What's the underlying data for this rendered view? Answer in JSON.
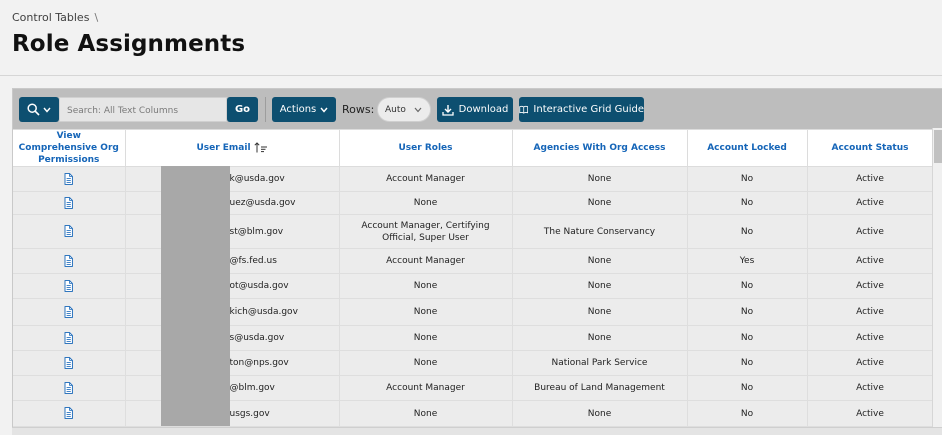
{
  "breadcrumb": {
    "parent": "Control Tables",
    "separator": "\\"
  },
  "page": {
    "title": "Role Assignments"
  },
  "toolbar": {
    "search_placeholder": "Search: All Text Columns",
    "go_label": "Go",
    "actions_label": "Actions",
    "rows_label": "Rows:",
    "rows_value": "Auto",
    "download_label": "Download",
    "guide_label": "Interactive Grid Guide"
  },
  "grid": {
    "columns": [
      "View Comprehensive Org Permissions",
      "User Email",
      "User Roles",
      "Agencies With Org Access",
      "Account Locked",
      "Account Status"
    ],
    "rows": [
      {
        "email": "k@usda.gov",
        "roles": "Account Manager",
        "agencies": "None",
        "locked": "No",
        "status": "Active"
      },
      {
        "email": "uez@usda.gov",
        "roles": "None",
        "agencies": "None",
        "locked": "No",
        "status": "Active"
      },
      {
        "email": "st@blm.gov",
        "roles": "Account Manager, Certifying Official, Super User",
        "agencies": "The Nature Conservancy",
        "locked": "No",
        "status": "Active"
      },
      {
        "email": "@fs.fed.us",
        "roles": "Account Manager",
        "agencies": "None",
        "locked": "Yes",
        "status": "Active"
      },
      {
        "email": "ot@usda.gov",
        "roles": "None",
        "agencies": "None",
        "locked": "No",
        "status": "Active"
      },
      {
        "email": "kich@usda.gov",
        "roles": "None",
        "agencies": "None",
        "locked": "No",
        "status": "Active"
      },
      {
        "email": "s@usda.gov",
        "roles": "None",
        "agencies": "None",
        "locked": "No",
        "status": "Active"
      },
      {
        "email": "ton@nps.gov",
        "roles": "None",
        "agencies": "National Park Service",
        "locked": "No",
        "status": "Active"
      },
      {
        "email": "@blm.gov",
        "roles": "Account Manager",
        "agencies": "Bureau of Land Management",
        "locked": "No",
        "status": "Active"
      },
      {
        "email": "usgs.gov",
        "roles": "None",
        "agencies": "None",
        "locked": "No",
        "status": "Active"
      }
    ]
  },
  "colors": {
    "accent": "#0d4f70",
    "link": "#1565b8",
    "toolbar": "#bdbdbd",
    "redaction": "#a8a8a8"
  },
  "icons": [
    "search-icon",
    "chevron-down-icon",
    "download-icon",
    "book-icon",
    "document-icon",
    "sort-ascending-icon"
  ]
}
